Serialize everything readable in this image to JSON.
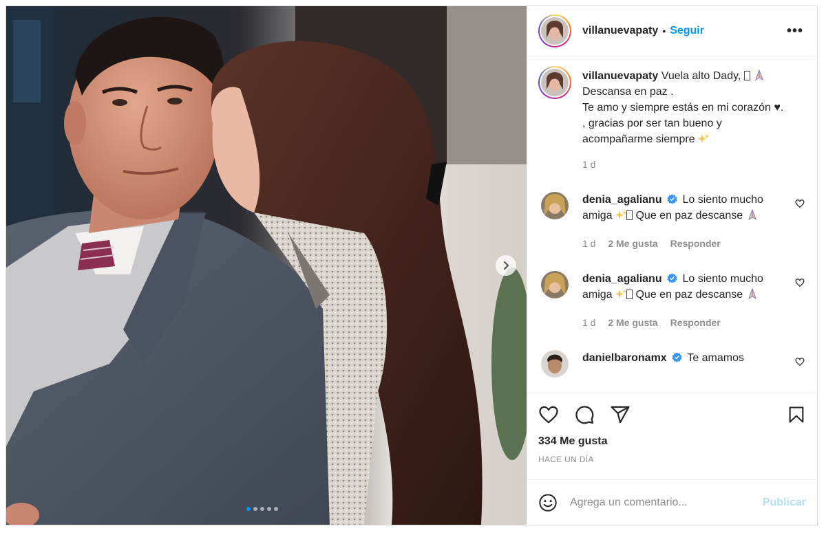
{
  "post": {
    "username": "villanuevapaty",
    "separator": "•",
    "follow_label": "Seguir",
    "more_label": "•••"
  },
  "caption": {
    "username": "villanuevapaty",
    "line1": "Vuela alto Dady, ",
    "line2": "Descansa en paz .",
    "line3": "Te amo y siempre estás en mi corazón ♥.",
    "line4": ", gracias por ser tan bueno y",
    "line5": "acompañarme siempre ",
    "age": "1 d"
  },
  "comments": [
    {
      "username": "denia_agalianu",
      "text_a": "Lo siento mucho",
      "text_b": "amiga ",
      "text_c": " Que en paz descanse ",
      "age": "1 d",
      "likes": "2 Me gusta",
      "reply": "Responder"
    },
    {
      "username": "denia_agalianu",
      "text_a": "Lo siento mucho",
      "text_b": "amiga ",
      "text_c": " Que en paz descanse ",
      "age": "1 d",
      "likes": "2 Me gusta",
      "reply": "Responder"
    },
    {
      "username": "danielbaronamx",
      "text_a": "Te amamos"
    }
  ],
  "likes_count": "334 Me gusta",
  "posted_time": "HACE UN DÍA",
  "add_comment": {
    "placeholder": "Agrega un comentario...",
    "publish_label": "Publicar"
  },
  "carousel": {
    "total": 5,
    "active": 1
  },
  "colors": {
    "accent": "#0095f6",
    "publish_disabled": "#b2dffc",
    "verified": "#3897f0",
    "muted": "#8e8e8e"
  },
  "icons": [
    "more-icon",
    "heart-icon",
    "comment-icon",
    "share-icon",
    "bookmark-icon",
    "emoji-icon",
    "verified-icon",
    "chevron-right-icon",
    "sparkles-icon",
    "praying-hands-icon"
  ]
}
